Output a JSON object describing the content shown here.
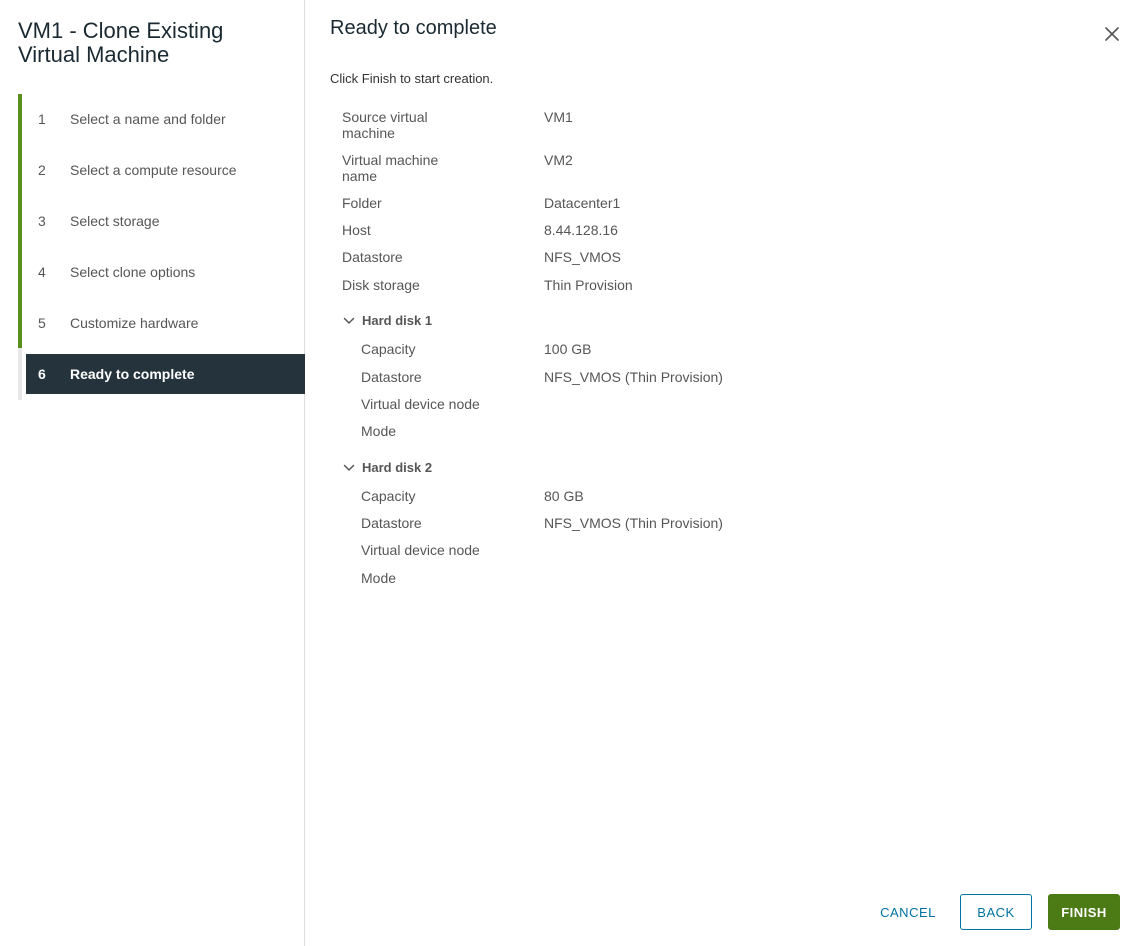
{
  "wizard": {
    "title": "VM1 - Clone Existing Virtual Machine",
    "steps": [
      {
        "num": "1",
        "label": "Select a name and folder"
      },
      {
        "num": "2",
        "label": "Select a compute resource"
      },
      {
        "num": "3",
        "label": "Select storage"
      },
      {
        "num": "4",
        "label": "Select clone options"
      },
      {
        "num": "5",
        "label": "Customize hardware"
      },
      {
        "num": "6",
        "label": "Ready to complete"
      }
    ],
    "active_step": "6",
    "accent_color": "#5a8f1f",
    "active_bg": "#25333d"
  },
  "page": {
    "title": "Ready to complete",
    "instructions": "Click Finish to start creation.",
    "close_icon": "close-icon"
  },
  "summary": {
    "source_vm_label": "Source virtual machine",
    "source_vm_value": "VM1",
    "vm_name_label": "Virtual machine name",
    "vm_name_value": "VM2",
    "folder_label": "Folder",
    "folder_value": "Datacenter1",
    "host_label": "Host",
    "host_value": "8.44.128.16",
    "datastore_label": "Datastore",
    "datastore_value": "NFS_VMOS",
    "disk_storage_label": "Disk storage",
    "disk_storage_value": "Thin Provision",
    "disks": [
      {
        "title": "Hard disk 1",
        "capacity_label": "Capacity",
        "capacity_value": "100 GB",
        "datastore_label": "Datastore",
        "datastore_value": "NFS_VMOS (Thin Provision)",
        "vdn_label": "Virtual device node",
        "vdn_value": "",
        "mode_label": "Mode",
        "mode_value": ""
      },
      {
        "title": "Hard disk 2",
        "capacity_label": "Capacity",
        "capacity_value": "80 GB",
        "datastore_label": "Datastore",
        "datastore_value": "NFS_VMOS (Thin Provision)",
        "vdn_label": "Virtual device node",
        "vdn_value": "",
        "mode_label": "Mode",
        "mode_value": ""
      }
    ]
  },
  "footer": {
    "cancel_label": "CANCEL",
    "back_label": "BACK",
    "finish_label": "FINISH",
    "primary_color": "#4c7a15",
    "link_color": "#0072a3"
  }
}
